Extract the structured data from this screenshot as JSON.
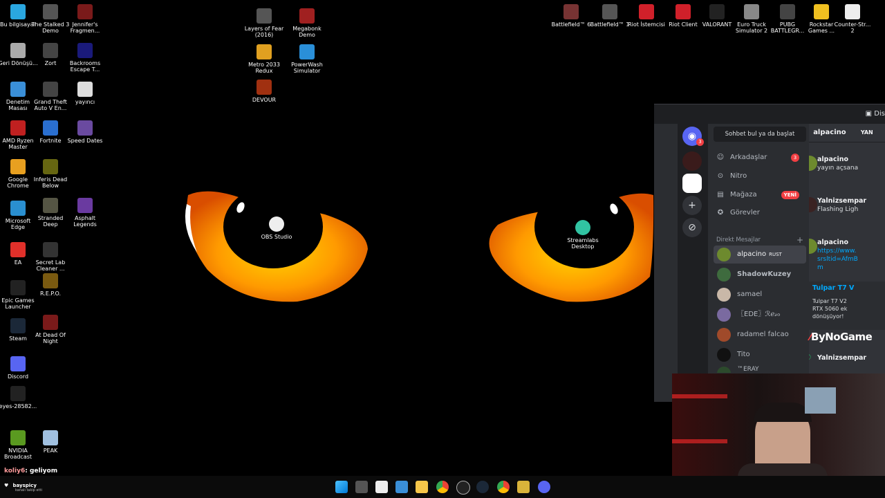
{
  "desktop": {
    "left_icons": [
      {
        "label": "Bu bilgisayar",
        "icon": "computer-icon"
      },
      {
        "label": "The Stalked 3 Demo",
        "icon": "game-icon"
      },
      {
        "label": "Jennifer's Fragmen...",
        "icon": "game-icon"
      },
      {
        "label": "Geri Dönüşü...",
        "icon": "recycle-bin-icon"
      },
      {
        "label": "Zort",
        "icon": "game-icon"
      },
      {
        "label": "Backrooms Escape T...",
        "icon": "game-icon"
      },
      {
        "label": "Denetim Masası",
        "icon": "control-panel-icon"
      },
      {
        "label": "Grand Theft Auto V En...",
        "icon": "game-icon"
      },
      {
        "label": "yayıncı",
        "icon": "document-icon"
      },
      {
        "label": "AMD Ryzen Master",
        "icon": "amd-icon"
      },
      {
        "label": "Fortnite",
        "icon": "game-icon"
      },
      {
        "label": "Speed Dates",
        "icon": "game-icon"
      },
      {
        "label": "Google Chrome",
        "icon": "chrome-icon"
      },
      {
        "label": "Inferis Dead Below",
        "icon": "game-icon"
      },
      {
        "label": "Microsoft Edge",
        "icon": "edge-icon"
      },
      {
        "label": "Stranded Deep",
        "icon": "game-icon"
      },
      {
        "label": "Asphalt Legends",
        "icon": "game-icon"
      },
      {
        "label": "EA",
        "icon": "ea-icon"
      },
      {
        "label": "Secret Lab Cleaner ...",
        "icon": "game-icon"
      },
      {
        "label": "Epic Games Launcher",
        "icon": "epic-icon"
      },
      {
        "label": "R.E.P.O.",
        "icon": "game-icon"
      },
      {
        "label": "Steam",
        "icon": "steam-icon"
      },
      {
        "label": "At Dead Of Night",
        "icon": "game-icon"
      },
      {
        "label": "Discord",
        "icon": "discord-icon"
      },
      {
        "label": "eyes-28582...",
        "icon": "image-file-icon"
      },
      {
        "label": "NVIDIA Broadcast",
        "icon": "nvidia-icon"
      },
      {
        "label": "PEAK",
        "icon": "game-icon"
      }
    ],
    "middle_icons": [
      {
        "label": "Layers of Fear (2016)",
        "icon": "game-icon"
      },
      {
        "label": "Megabonk Demo",
        "icon": "game-icon"
      },
      {
        "label": "Metro 2033 Redux",
        "icon": "game-icon"
      },
      {
        "label": "PowerWash Simulator",
        "icon": "game-icon"
      },
      {
        "label": "DEVOUR",
        "icon": "game-icon"
      },
      {
        "label": "OBS Studio",
        "icon": "obs-icon"
      },
      {
        "label": "Streamlabs Desktop",
        "icon": "streamlabs-icon"
      }
    ],
    "top_right_icons": [
      {
        "label": "Battlefield™ 6",
        "icon": "game-icon"
      },
      {
        "label": "Battlefield™ 1",
        "icon": "game-icon"
      },
      {
        "label": "Riot İstemcisi",
        "icon": "riot-icon"
      },
      {
        "label": "Riot Client",
        "icon": "riot-icon"
      },
      {
        "label": "VALORANT",
        "icon": "valorant-icon"
      },
      {
        "label": "Euro Truck Simulator 2",
        "icon": "game-icon"
      },
      {
        "label": "PUBG BATTLEGR...",
        "icon": "game-icon"
      },
      {
        "label": "Rockstar Games ...",
        "icon": "rockstar-icon"
      },
      {
        "label": "Counter-Str... 2",
        "icon": "document-icon"
      }
    ]
  },
  "discord": {
    "title_fragment": "Dis",
    "search_label": "Sohbet bul ya da başlat",
    "notification_count": "3",
    "nav": [
      {
        "label": "Arkadaşlar",
        "icon": "friends-icon",
        "badge": "3"
      },
      {
        "label": "Nitro",
        "icon": "nitro-icon",
        "badge": ""
      },
      {
        "label": "Mağaza",
        "icon": "shop-icon",
        "badge": "YENİ"
      },
      {
        "label": "Görevler",
        "icon": "quests-icon",
        "badge": ""
      }
    ],
    "dm_header": "Direkt Mesajlar",
    "dms": [
      {
        "name": "alpacino",
        "tag": "RUST",
        "active": true
      },
      {
        "name": "ShadowKuzey",
        "tag": ""
      },
      {
        "name": "samael",
        "tag": ""
      },
      {
        "name": "〖EDE〗ℛℯ𝓈ℴ",
        "tag": ""
      },
      {
        "name": "radamel falcao",
        "tag": ""
      },
      {
        "name": "Tito",
        "tag": ""
      },
      {
        "name": "™ERAY",
        "tag": ""
      }
    ],
    "chat_header": {
      "name": "alpacino",
      "suffix": "YAN"
    },
    "messages": [
      {
        "author": "alpacino",
        "text": "yayın açsana"
      },
      {
        "author": "Yalnizsempar",
        "text": "Flashing Ligh"
      },
      {
        "author": "alpacino",
        "text": "https://www.",
        "text2": "srsltid=AfmB",
        "text3": "m"
      },
      {
        "embed_title": "Tulpar T7 V",
        "embed_text": "Tulpar T7 V2",
        "embed_text2": "RTX 5060 ek",
        "embed_text3": "dönüşüyor!"
      },
      {
        "author": "Yalnizsempar",
        "text": ""
      }
    ]
  },
  "overlay": {
    "watermark": "ByNoGame",
    "chat_user": "koliy6",
    "chat_message": ": geliyom",
    "follower_name": "bayspicy",
    "follower_sub": "kanalı takip etti"
  },
  "colors": {
    "eye_orange": "#ff8a00",
    "discord_blurple": "#5865f2",
    "badge_red": "#f23f43"
  }
}
